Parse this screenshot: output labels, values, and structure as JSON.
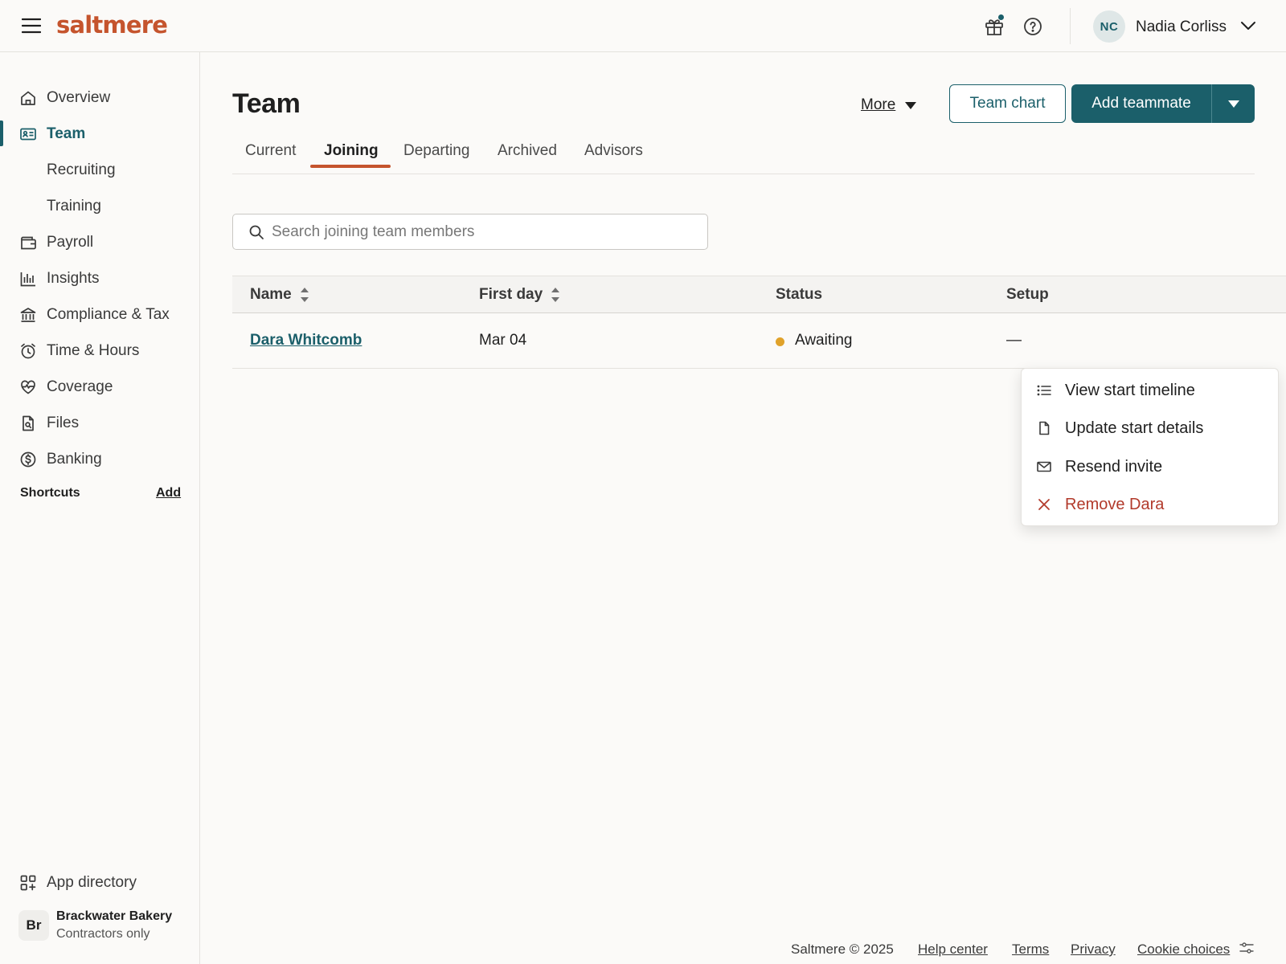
{
  "brand": {
    "logo": "saltmere",
    "accent": "#c5542d",
    "primary": "#1b5f6a"
  },
  "topbar": {
    "user_initials": "NC",
    "user_name": "Nadia Corliss",
    "icons": [
      "menu-icon",
      "gift-icon",
      "help-icon",
      "chevron-down-icon"
    ]
  },
  "sidebar": {
    "items": [
      {
        "label": "Overview",
        "icon": "home-icon"
      },
      {
        "label": "Team",
        "icon": "id-card-icon",
        "active": true
      },
      {
        "label": "Recruiting"
      },
      {
        "label": "Training"
      },
      {
        "label": "Payroll",
        "icon": "wallet-icon"
      },
      {
        "label": "Insights",
        "icon": "bar-chart-icon"
      },
      {
        "label": "Compliance & Tax",
        "icon": "bank-icon"
      },
      {
        "label": "Time & Hours",
        "icon": "alarm-clock-icon"
      },
      {
        "label": "Coverage",
        "icon": "heart-pulse-icon"
      },
      {
        "label": "Files",
        "icon": "file-search-icon"
      },
      {
        "label": "Banking",
        "icon": "dollar-circle-icon"
      }
    ],
    "shortcuts_title": "Shortcuts",
    "shortcuts_add": "Add",
    "app_directory": "App directory",
    "company": {
      "badge": "Br",
      "name": "Brackwater Bakery",
      "subtitle": "Contractors only"
    }
  },
  "main": {
    "title": "Team",
    "more_label": "More",
    "team_chart_label": "Team chart",
    "add_teammate_label": "Add teammate",
    "tabs": [
      {
        "label": "Current"
      },
      {
        "label": "Joining",
        "active": true
      },
      {
        "label": "Departing"
      },
      {
        "label": "Archived"
      },
      {
        "label": "Advisors"
      }
    ],
    "search": {
      "placeholder": "Search joining team members",
      "value": ""
    },
    "table": {
      "columns": [
        "Name",
        "First day",
        "Status",
        "Setup"
      ],
      "rows": [
        {
          "name": "Dara Whitcomb",
          "first_day": "Mar 04",
          "status": "Awaiting",
          "status_color": "#e0a22a",
          "setup": "—"
        }
      ]
    },
    "row_menu": [
      {
        "label": "View start timeline",
        "icon": "list-icon"
      },
      {
        "label": "Update start details",
        "icon": "document-icon"
      },
      {
        "label": "Resend invite",
        "icon": "envelope-icon"
      },
      {
        "label": "Remove Dara",
        "icon": "close-icon",
        "danger_color": "#b23a2b"
      }
    ]
  },
  "footer": {
    "copyright": "Saltmere © 2025",
    "links": [
      "Help center",
      "Terms",
      "Privacy",
      "Cookie choices"
    ]
  }
}
